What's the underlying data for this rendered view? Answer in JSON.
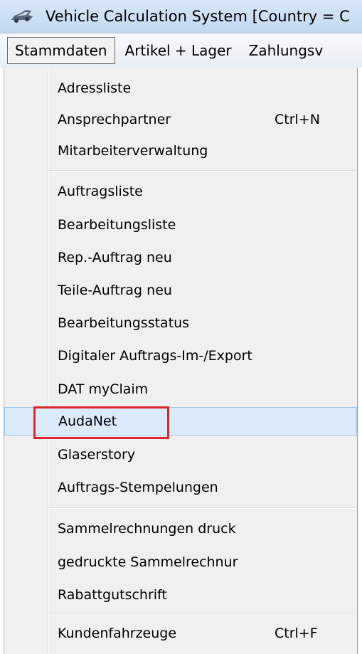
{
  "window": {
    "title": "Vehicle Calculation System [Country = C",
    "icon": "car-icon"
  },
  "menubar": {
    "items": [
      {
        "label": "Stammdaten",
        "active": true
      },
      {
        "label": "Artikel + Lager"
      },
      {
        "label": "Zahlungsv"
      }
    ]
  },
  "dropdown": {
    "items": [
      {
        "label": "Adressliste"
      },
      {
        "label": "Ansprechpartner",
        "shortcut": "Ctrl+N"
      },
      {
        "label": "Mitarbeiterverwaltung"
      },
      {
        "label": "Auftragsliste"
      },
      {
        "label": "Bearbeitungsliste"
      },
      {
        "label": "Rep.-Auftrag neu"
      },
      {
        "label": "Teile-Auftrag neu"
      },
      {
        "label": "Bearbeitungsstatus"
      },
      {
        "label": "Digitaler Auftrags-Im-/Export"
      },
      {
        "label": "DAT myClaim"
      },
      {
        "label": "AudaNet",
        "highlighted": true
      },
      {
        "label": "Glaserstory"
      },
      {
        "label": "Auftrags-Stempelungen"
      },
      {
        "label": "Sammelrechnungen druck"
      },
      {
        "label": "gedruckte Sammelrechnur"
      },
      {
        "label": "Rabattgutschrift"
      },
      {
        "label": "Kundenfahrzeuge",
        "shortcut": "Ctrl+F"
      }
    ]
  },
  "colors": {
    "highlight_bg": "#dcebfb",
    "highlight_border": "#9cc3e8",
    "annotation": "#d9262f"
  }
}
